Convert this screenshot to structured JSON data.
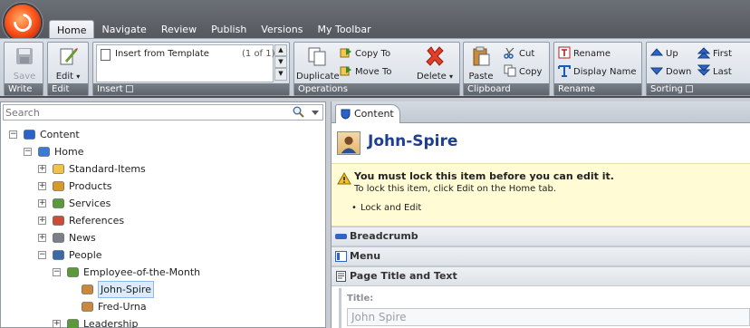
{
  "ribbon": {
    "tabs": [
      "Home",
      "Navigate",
      "Review",
      "Publish",
      "Versions",
      "My Toolbar"
    ],
    "groups": {
      "write": {
        "label": "Write",
        "save": "Save"
      },
      "edit": {
        "label": "Edit",
        "edit": "Edit"
      },
      "insert": {
        "label": "Insert",
        "item": "Insert from Template",
        "count": "(1 of 1)"
      },
      "operations": {
        "label": "Operations",
        "duplicate": "Duplicate",
        "copy_to": "Copy To",
        "move_to": "Move To",
        "delete": "Delete"
      },
      "clipboard": {
        "label": "Clipboard",
        "paste": "Paste",
        "cut": "Cut",
        "copy": "Copy"
      },
      "rename": {
        "label": "Rename",
        "rename": "Rename",
        "display_name": "Display Name"
      },
      "sorting": {
        "label": "Sorting",
        "up": "Up",
        "down": "Down",
        "first": "First",
        "last": "Last"
      }
    }
  },
  "search": {
    "placeholder": "Search"
  },
  "tree": [
    {
      "label": "Content",
      "icon": "content-icon",
      "expander": "minus"
    },
    {
      "label": "Home",
      "icon": "home-icon",
      "expander": "minus"
    },
    {
      "label": "Standard-Items",
      "icon": "folder-icon",
      "expander": "plus"
    },
    {
      "label": "Products",
      "icon": "products-icon",
      "expander": "plus"
    },
    {
      "label": "Services",
      "icon": "services-icon",
      "expander": "plus"
    },
    {
      "label": "References",
      "icon": "references-icon",
      "expander": "plus"
    },
    {
      "label": "News",
      "icon": "news-icon",
      "expander": "plus"
    },
    {
      "label": "People",
      "icon": "people-icon",
      "expander": "minus"
    },
    {
      "label": "Employee-of-the-Month",
      "icon": "group-icon",
      "expander": "minus"
    },
    {
      "label": "John-Spire",
      "icon": "person-icon",
      "expander": ""
    },
    {
      "label": "Fred-Urna",
      "icon": "person-icon",
      "expander": ""
    },
    {
      "label": "Leadership",
      "icon": "group-icon",
      "expander": "plus"
    }
  ],
  "content_tab": {
    "label": "Content"
  },
  "item": {
    "title": "John-Spire"
  },
  "warning": {
    "title": "You must lock this item before you can edit it.",
    "subtitle": "To lock this item, click Edit on the Home tab.",
    "link": "Lock and Edit"
  },
  "sections": [
    "Breadcrumb",
    "Menu",
    "Page Title and Text"
  ],
  "field": {
    "label": "Title:",
    "value": "John Spire"
  },
  "colors": {
    "accent": "#1d3f8f",
    "warning_bg": "#fffbd5",
    "selection": "#dcebfb"
  }
}
